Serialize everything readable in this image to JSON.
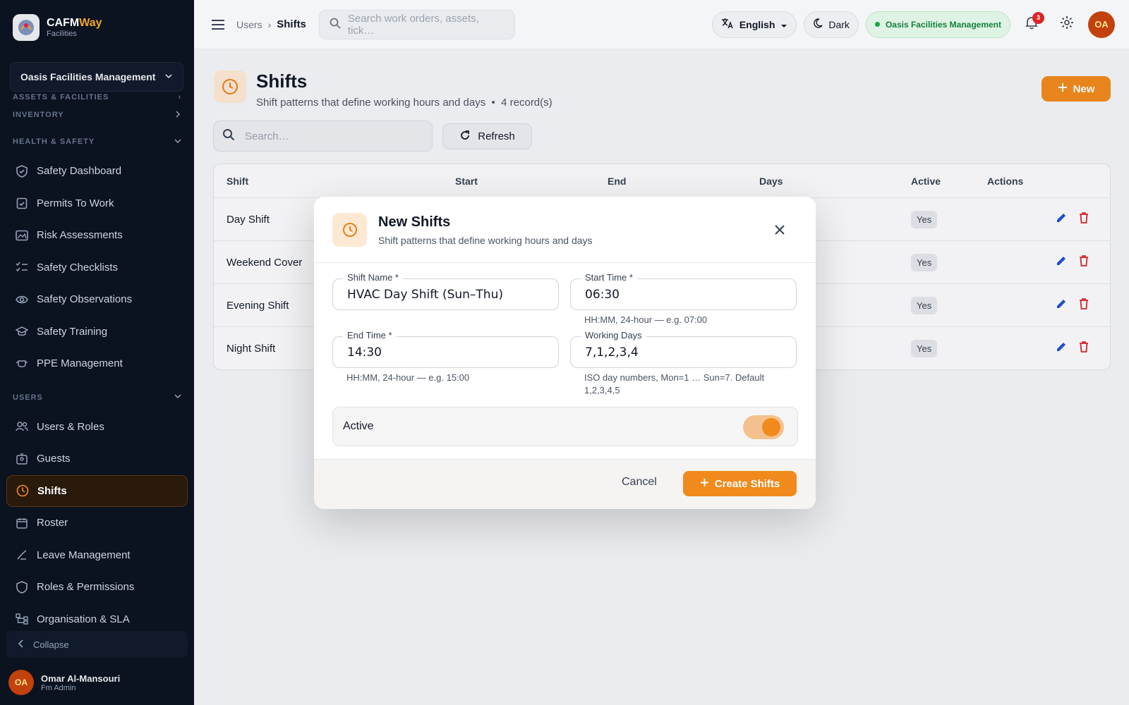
{
  "brand": {
    "name_main": "CAFM",
    "name_accent": "Way",
    "sub": "Facilities"
  },
  "org_select": {
    "value": "Oasis Facilities Management"
  },
  "nav": {
    "cut_section": "ASSETS & FACILITIES",
    "inventory": "INVENTORY",
    "health_safety": "HEALTH & SAFETY",
    "safety_items": [
      {
        "label": "Safety Dashboard",
        "icon": "shield-check-icon"
      },
      {
        "label": "Permits To Work",
        "icon": "clipboard-check-icon"
      },
      {
        "label": "Risk Assessments",
        "icon": "image-alert-icon"
      },
      {
        "label": "Safety Checklists",
        "icon": "checklist-icon"
      },
      {
        "label": "Safety Observations",
        "icon": "eye-icon"
      },
      {
        "label": "Safety Training",
        "icon": "graduation-cap-icon"
      },
      {
        "label": "PPE Management",
        "icon": "mask-icon"
      }
    ],
    "users_section": "USERS",
    "user_items": [
      {
        "label": "Users & Roles",
        "icon": "users-icon"
      },
      {
        "label": "Guests",
        "icon": "badge-icon"
      },
      {
        "label": "Shifts",
        "icon": "clock-icon"
      },
      {
        "label": "Roster",
        "icon": "calendar-icon"
      },
      {
        "label": "Leave Management",
        "icon": "leave-icon"
      },
      {
        "label": "Roles & Permissions",
        "icon": "shield-icon"
      },
      {
        "label": "Organisation & SLA",
        "icon": "org-chart-icon"
      }
    ],
    "collapse": "Collapse"
  },
  "user": {
    "initials": "OA",
    "name": "Omar Al-Mansouri",
    "role": "Fm Admin"
  },
  "topbar": {
    "breadcrumb": [
      "Users",
      "Shifts"
    ],
    "search_placeholder": "Search work orders, assets, tick…",
    "language": "English",
    "theme": "Dark",
    "org": "Oasis Facilities Management",
    "notifications": "3",
    "avatar": "OA"
  },
  "page": {
    "title": "Shifts",
    "subtitle": "Shift patterns that define working hours and days",
    "records": "4 record(s)",
    "new_label": "New",
    "search_placeholder": "Search…",
    "refresh_label": "Refresh"
  },
  "table": {
    "columns": [
      "Shift",
      "Start",
      "End",
      "Days",
      "Active",
      "Actions"
    ],
    "rows": [
      {
        "name": "Day Shift",
        "active": "Yes"
      },
      {
        "name": "Weekend Cover",
        "active": "Yes"
      },
      {
        "name": "Evening Shift",
        "active": "Yes"
      },
      {
        "name": "Night Shift",
        "active": "Yes"
      }
    ]
  },
  "modal": {
    "title": "New Shifts",
    "subtitle": "Shift patterns that define working hours and days",
    "shift_name_label": "Shift Name *",
    "shift_name_value": "HVAC Day Shift (Sun–Thu)",
    "start_label": "Start Time *",
    "start_value": "06:30",
    "start_help": "HH:MM, 24-hour — e.g. 07:00",
    "end_label": "End Time *",
    "end_value": "14:30",
    "end_help": "HH:MM, 24-hour — e.g. 15:00",
    "days_label": "Working Days",
    "days_value": "7,1,2,3,4",
    "days_help": "ISO day numbers, Mon=1 … Sun=7. Default 1,2,3,4,5",
    "active_label": "Active",
    "active_on": true,
    "cancel_label": "Cancel",
    "create_label": "Create Shifts"
  },
  "colors": {
    "accent": "#f08a1c",
    "sidebar": "#0b1220",
    "success": "#15803d",
    "danger": "#dc2626"
  }
}
